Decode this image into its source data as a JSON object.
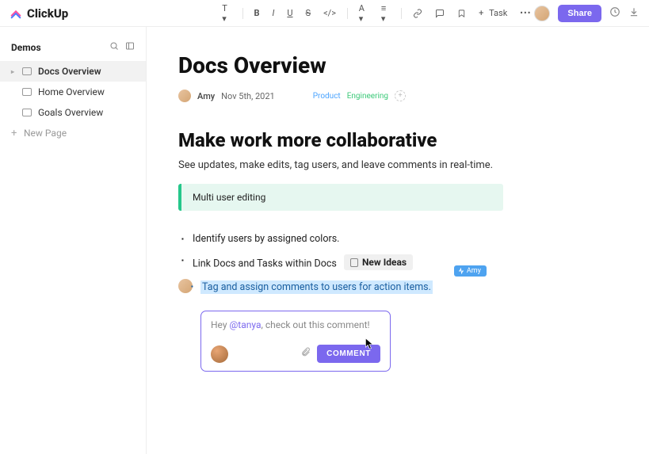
{
  "brand": {
    "name": "ClickUp"
  },
  "toolbar": {
    "task_label": "Task",
    "task_prefix": "+"
  },
  "header": {
    "share_label": "Share"
  },
  "sidebar": {
    "title": "Demos",
    "items": [
      {
        "label": "Docs Overview",
        "active": true
      },
      {
        "label": "Home Overview",
        "active": false
      },
      {
        "label": "Goals Overview",
        "active": false
      }
    ],
    "new_page_label": "New Page"
  },
  "doc": {
    "title": "Docs Overview",
    "author": "Amy",
    "date": "Nov 5th, 2021",
    "tags": {
      "product": "Product",
      "engineering": "Engineering"
    },
    "h2": "Make work more collaborative",
    "subtitle": "See updates, make edits, tag users, and leave comments in real-time.",
    "callout": "Multi user editing",
    "bullets": [
      "Identify users by assigned colors.",
      "Link Docs and Tasks within Docs"
    ],
    "chip": "New Ideas",
    "highlighted": "Tag and assign comments to users for action items.",
    "presence_user": "Amy"
  },
  "comment": {
    "prefix": "Hey ",
    "mention": "@tanya",
    "suffix": ", check out this comment!",
    "button": "COMMENT"
  }
}
